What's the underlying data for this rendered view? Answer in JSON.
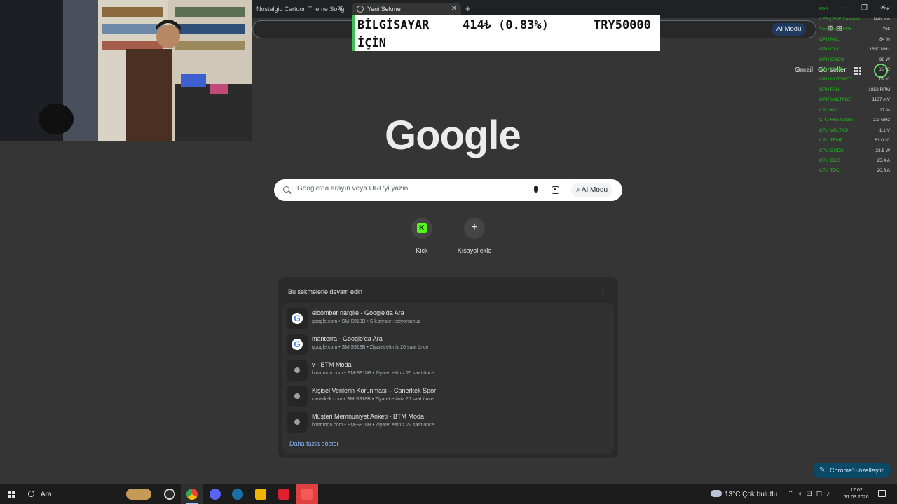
{
  "tabs": [
    {
      "title": "Nostalgic Cartoon Theme Song",
      "close": "✕"
    },
    {
      "title": "Yeni Sekme",
      "close": "✕"
    }
  ],
  "new_tab": "+",
  "window_controls": [
    "—",
    "❐",
    "✕"
  ],
  "omnibox": {
    "ai_label": "AI Modu"
  },
  "ticker": {
    "line1": "BİLGİSAYAR",
    "line2": "İÇİN",
    "change": "414₺ (0.83%)",
    "symbol": "TRY50000"
  },
  "top_links": {
    "gmail": "Gmail",
    "images": "Görseller"
  },
  "hw_monitor": [
    {
      "label": "FPS",
      "value": "YOK"
    },
    {
      "label": "ÇERÇEVE ZAMANI",
      "value": "NaN ms"
    },
    {
      "label": "YERLEŞİK FPS",
      "value": "Yok"
    },
    {
      "label": "GPU KUL",
      "value": "84 %"
    },
    {
      "label": "GPU CLK",
      "value": "1680 MHz"
    },
    {
      "label": "GPU GÜCÜ",
      "value": "96 W"
    },
    {
      "label": "GPU TEMP",
      "value": "65 °C"
    },
    {
      "label": "GPU HOTSPOT",
      "value": "78 °C"
    },
    {
      "label": "GPU FAN",
      "value": "1852 RPM"
    },
    {
      "label": "GPU VOLTAGE",
      "value": "1137 mV"
    },
    {
      "label": "CPU KUL",
      "value": "17 %"
    },
    {
      "label": "CPU FREKANSI",
      "value": "2.3 GHz"
    },
    {
      "label": "CPU VOLTAJI",
      "value": "1.1 V"
    },
    {
      "label": "CPU TEMP",
      "value": "61.0 °C"
    },
    {
      "label": "CPU GÜCÜ",
      "value": "23.5 W"
    },
    {
      "label": "CPU EDC",
      "value": "25.4 A"
    },
    {
      "label": "CPU TDC",
      "value": "20.6 A"
    }
  ],
  "google": {
    "logo": "Google",
    "search_placeholder": "Google'da arayın veya URL'yi yazın",
    "ai_label": "AI Modu"
  },
  "shortcuts": [
    {
      "label": "Kick",
      "glyph": "K"
    },
    {
      "label": "Kısayol ekle",
      "glyph": "+"
    }
  ],
  "continue_panel": {
    "title": "Bu sekmelerle devam edin",
    "menu": "⋮",
    "items": [
      {
        "title": "elbomber nargile - Google'da Ara",
        "sub": "google.com • SM-S918B • Sık ziyaret ediyorsunuz",
        "icon": "google-icon"
      },
      {
        "title": "manterra - Google'da Ara",
        "sub": "google.com • SM-S918B • Ziyaret ettiniz 20 saat önce",
        "icon": "google-icon"
      },
      {
        "title": "v - BTM Moda",
        "sub": "btmmoda.com • SM-S918B • Ziyaret ettiniz 20 saat önce",
        "icon": "globe-icon"
      },
      {
        "title": "Kişisel Verilerin Korunması – Canerkek Spor",
        "sub": "canerkek.com • SM-S918B • Ziyaret ettiniz 20 saat önce",
        "icon": "globe-icon"
      },
      {
        "title": "Müşteri Memnuniyet Anketi - BTM Moda",
        "sub": "btmmoda.com • SM-S918B • Ziyaret ettiniz 22 saat önce",
        "icon": "globe-icon"
      }
    ],
    "more": "Daha fazla göster"
  },
  "customize": "Chrome'u özelleştir",
  "taskbar": {
    "search_label": "Ara",
    "weather": "13°C  Çok bulutlu",
    "time": "17:02",
    "date": "31.03.2026"
  }
}
